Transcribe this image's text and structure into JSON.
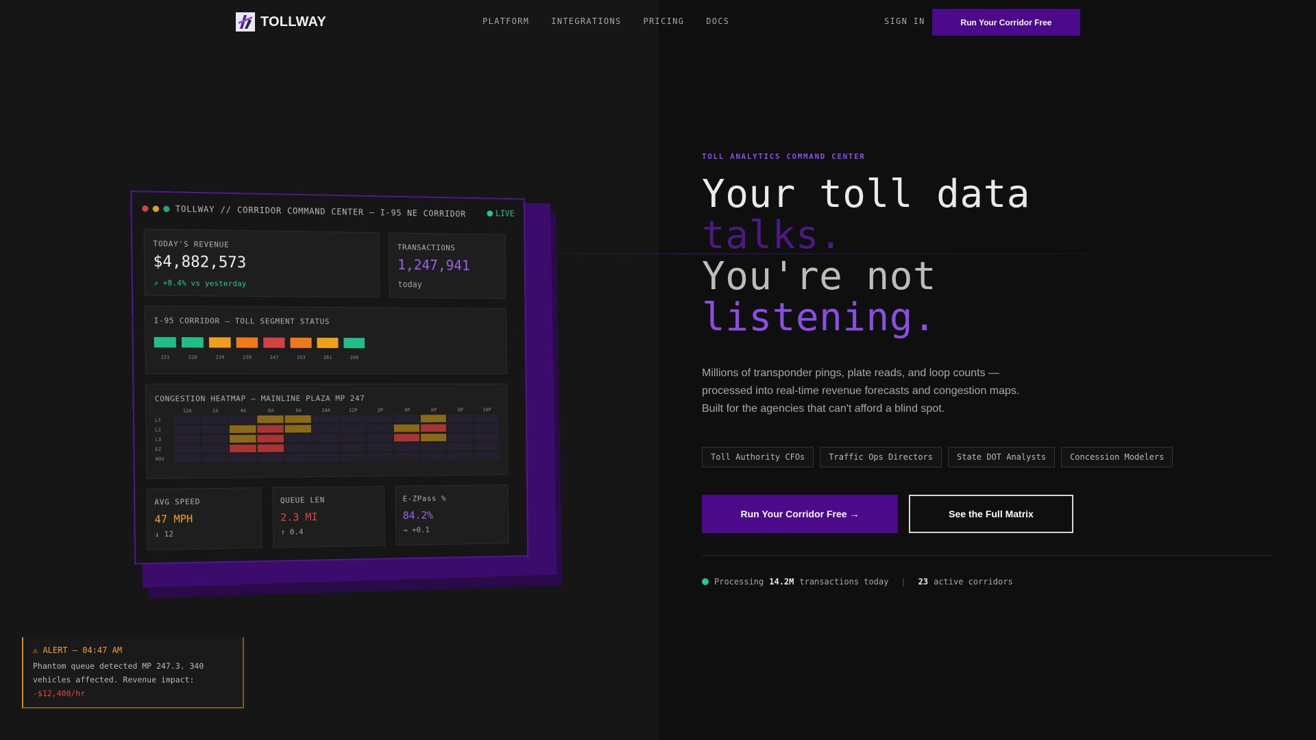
{
  "nav": {
    "brand": "TOLLWAY",
    "links": [
      "PLATFORM",
      "INTEGRATIONS",
      "PRICING",
      "DOCS"
    ],
    "sign_in": "SIGN IN",
    "cta": "Run Your Corridor Free"
  },
  "dashboard": {
    "title": "TOLLWAY // CORRIDOR COMMAND CENTER — I-95 NE CORRIDOR",
    "live": "LIVE",
    "revenue": {
      "label": "TODAY'S REVENUE",
      "value": "$4,882,573",
      "delta": "↗ +8.4% vs yesterday"
    },
    "transactions": {
      "label": "TRANSACTIONS",
      "value": "1,247,941",
      "sub": "today"
    },
    "segments": {
      "label": "I-95 CORRIDOR — TOLL SEGMENT STATUS",
      "items": [
        {
          "id": "221",
          "color": "#1fbf87"
        },
        {
          "id": "228",
          "color": "#1fbf87"
        },
        {
          "id": "234",
          "color": "#f0a018"
        },
        {
          "id": "239",
          "color": "#f07a18"
        },
        {
          "id": "247",
          "color": "#d24444"
        },
        {
          "id": "253",
          "color": "#f07a18"
        },
        {
          "id": "261",
          "color": "#f0a018"
        },
        {
          "id": "268",
          "color": "#1fbf87"
        }
      ]
    },
    "heatmap": {
      "label": "CONGESTION HEATMAP — MAINLINE PLAZA MP 247",
      "columns": [
        "12A",
        "2A",
        "4A",
        "6A",
        "8A",
        "10A",
        "12P",
        "2P",
        "4P",
        "6P",
        "8P",
        "10P"
      ],
      "rows": [
        "L1",
        "L2",
        "L3",
        "EZ",
        "HOV"
      ],
      "hot_cells": [
        {
          "row": 0,
          "col": 3,
          "level": "amber"
        },
        {
          "row": 0,
          "col": 4,
          "level": "amber"
        },
        {
          "row": 0,
          "col": 9,
          "level": "amber"
        },
        {
          "row": 1,
          "col": 2,
          "level": "amber"
        },
        {
          "row": 1,
          "col": 3,
          "level": "red"
        },
        {
          "row": 1,
          "col": 4,
          "level": "amber"
        },
        {
          "row": 1,
          "col": 8,
          "level": "amber"
        },
        {
          "row": 1,
          "col": 9,
          "level": "red"
        },
        {
          "row": 2,
          "col": 2,
          "level": "amber"
        },
        {
          "row": 2,
          "col": 3,
          "level": "red"
        },
        {
          "row": 2,
          "col": 8,
          "level": "red"
        },
        {
          "row": 2,
          "col": 9,
          "level": "amber"
        },
        {
          "row": 3,
          "col": 2,
          "level": "red"
        },
        {
          "row": 3,
          "col": 3,
          "level": "red"
        }
      ],
      "colors": {
        "amber": "#8a6a18",
        "red": "#a83434",
        "empty": "#252030"
      }
    },
    "metrics": [
      {
        "label": "AVG SPEED",
        "value": "47 MPH",
        "sub": "↓ 12",
        "color": "#f0a030"
      },
      {
        "label": "QUEUE LEN",
        "value": "2.3 MI",
        "sub": "↑ 0.4",
        "color": "#e04848"
      },
      {
        "label": "E-ZPass %",
        "value": "84.2%",
        "sub": "→ +0.1",
        "color": "#9a60f0"
      }
    ]
  },
  "alert": {
    "title": "⚠ ALERT — 04:47 AM",
    "body": "Phantom queue detected MP 247.3. 340 vehicles affected. Revenue impact:",
    "impact": "-$12,400/hr"
  },
  "hero": {
    "eyebrow": "TOLL ANALYTICS COMMAND CENTER",
    "line1": "Your toll data",
    "line2": "talks.",
    "line3": "You're not",
    "line4": "listening.",
    "description": "Millions of transponder pings, plate reads, and loop counts — processed into real-time revenue forecasts and congestion maps. Built for the agencies that can't afford a blind spot.",
    "chips": [
      "Toll Authority CFOs",
      "Traffic Ops Directors",
      "State DOT Analysts",
      "Concession Modelers"
    ],
    "primary_cta": "Run Your Corridor Free →",
    "secondary_cta": "See the Full Matrix",
    "stats": {
      "prefix": "Processing",
      "tx_count": "14.2M",
      "tx_suffix": "transactions today",
      "separator": "|",
      "corridor_count": "23",
      "corridor_suffix": "active corridors"
    }
  }
}
